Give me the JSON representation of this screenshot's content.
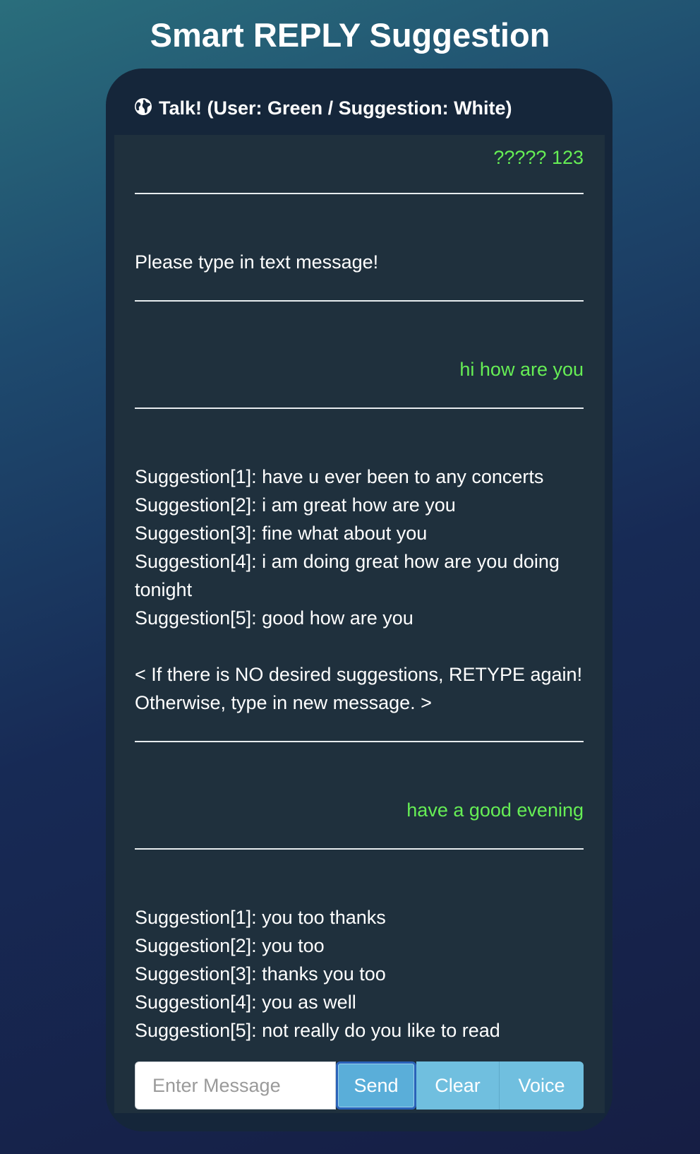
{
  "page": {
    "title": "Smart REPLY Suggestion"
  },
  "chat": {
    "header_icon": "globe-icon",
    "header_title": "Talk! (User: Green / Suggestion: White)",
    "user_color": "#66ee55",
    "suggestion_color": "#ffffff",
    "messages": [
      {
        "role": "user",
        "text": "????? 123"
      },
      {
        "role": "bot",
        "text": "Please type in text message!"
      },
      {
        "role": "user",
        "text": "hi how are you"
      },
      {
        "role": "bot",
        "text": "Suggestion[1]: have u ever been to any concerts\nSuggestion[2]: i am great how are you\nSuggestion[3]: fine what about you\nSuggestion[4]: i am doing great how are you doing tonight\nSuggestion[5]: good how are you\n\n< If there is NO desired suggestions, RETYPE again! Otherwise, type in new message. >"
      },
      {
        "role": "user",
        "text": "have a good evening"
      },
      {
        "role": "bot",
        "text": "Suggestion[1]: you too thanks\nSuggestion[2]: you too\nSuggestion[3]: thanks you too\nSuggestion[4]: you as well\nSuggestion[5]: not really do you like to read"
      }
    ]
  },
  "input_bar": {
    "placeholder": "Enter Message",
    "value": "",
    "send_label": "Send",
    "clear_label": "Clear",
    "voice_label": "Voice",
    "button_color": "#70bfdf",
    "send_border_color": "#2a62b8"
  }
}
